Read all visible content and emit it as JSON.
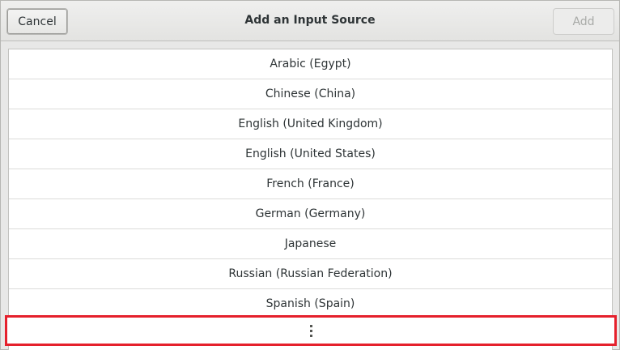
{
  "header": {
    "title": "Add an Input Source",
    "cancel_label": "Cancel",
    "add_label": "Add"
  },
  "languages": [
    "Arabic (Egypt)",
    "Chinese (China)",
    "English (United Kingdom)",
    "English (United States)",
    "French (France)",
    "German (Germany)",
    "Japanese",
    "Russian (Russian Federation)",
    "Spanish (Spain)"
  ],
  "more_row": {
    "icon": "view-more-icon"
  },
  "colors": {
    "highlight_border": "#e5202c"
  }
}
